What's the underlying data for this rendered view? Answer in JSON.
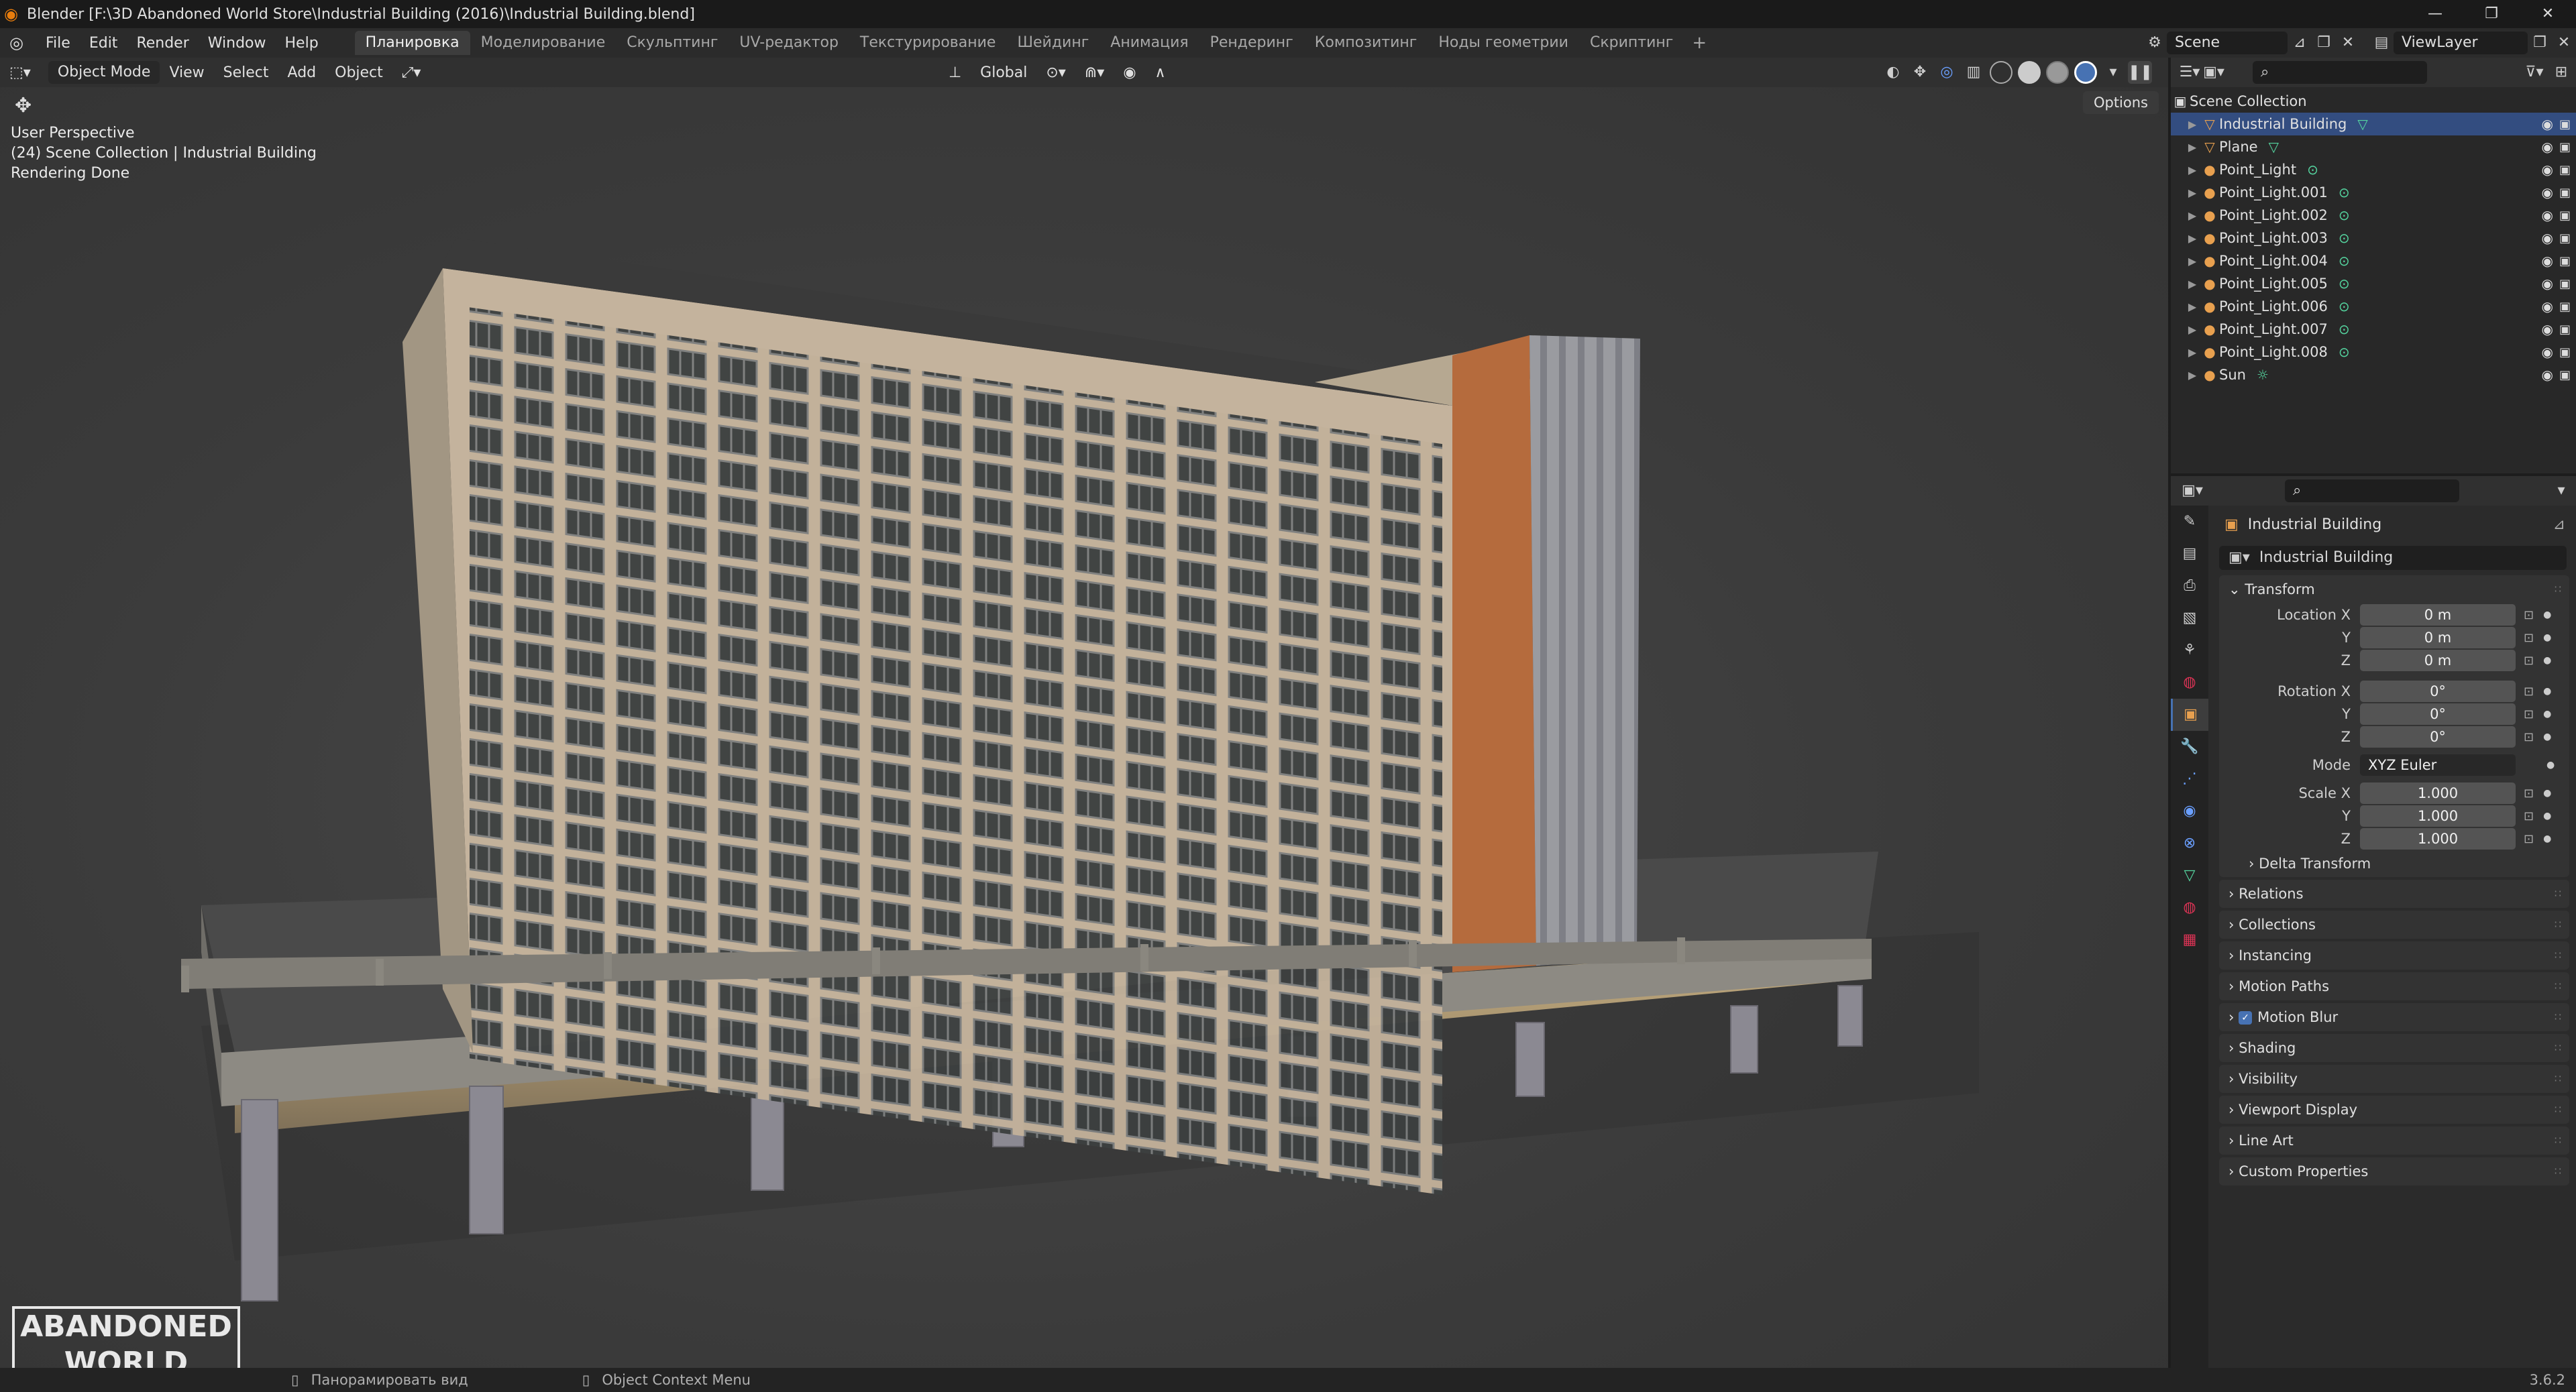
{
  "window": {
    "title": "Blender [F:\\3D Abandoned World Store\\Industrial Building (2016)\\Industrial Building.blend]",
    "controls": [
      "—",
      "❐",
      "✕"
    ]
  },
  "menu": {
    "items": [
      "File",
      "Edit",
      "Render",
      "Window",
      "Help"
    ]
  },
  "workspaces": [
    "Планировка",
    "Моделирование",
    "Скульптинг",
    "UV-редактор",
    "Текстурирование",
    "Шейдинг",
    "Анимация",
    "Рендеринг",
    "Композитинг",
    "Ноды геометрии",
    "Скриптинг"
  ],
  "active_workspace": "Планировка",
  "scene": {
    "name": "Scene",
    "view_layer": "ViewLayer"
  },
  "viewport_header": {
    "mode": "Object Mode",
    "menus": [
      "View",
      "Select",
      "Add",
      "Object"
    ],
    "orientation": "Global"
  },
  "viewport": {
    "perspective": "User Perspective",
    "collection_info": "(24) Scene Collection | Industrial Building",
    "render_status": "Rendering Done",
    "options_label": "Options",
    "logo_line1": "ABANDONED",
    "logo_line2": "WORLD"
  },
  "outliner": {
    "root": "Scene Collection",
    "items": [
      {
        "name": "Industrial Building",
        "type": "mesh",
        "selected": true
      },
      {
        "name": "Plane",
        "type": "mesh",
        "selected": false
      },
      {
        "name": "Point_Light",
        "type": "light",
        "selected": false
      },
      {
        "name": "Point_Light.001",
        "type": "light",
        "selected": false
      },
      {
        "name": "Point_Light.002",
        "type": "light",
        "selected": false
      },
      {
        "name": "Point_Light.003",
        "type": "light",
        "selected": false
      },
      {
        "name": "Point_Light.004",
        "type": "light",
        "selected": false
      },
      {
        "name": "Point_Light.005",
        "type": "light",
        "selected": false
      },
      {
        "name": "Point_Light.006",
        "type": "light",
        "selected": false
      },
      {
        "name": "Point_Light.007",
        "type": "light",
        "selected": false
      },
      {
        "name": "Point_Light.008",
        "type": "light",
        "selected": false
      },
      {
        "name": "Sun",
        "type": "sun",
        "selected": false
      }
    ]
  },
  "properties": {
    "object_name": "Industrial Building",
    "data_name": "Industrial Building",
    "transform_label": "Transform",
    "location": {
      "label": "Location X",
      "x": "0 m",
      "y": "0 m",
      "z": "0 m"
    },
    "rotation": {
      "label": "Rotation X",
      "x": "0°",
      "y": "0°",
      "z": "0°"
    },
    "mode": {
      "label": "Mode",
      "value": "XYZ Euler"
    },
    "scale": {
      "label": "Scale X",
      "x": "1.000",
      "y": "1.000",
      "z": "1.000"
    },
    "axis_y": "Y",
    "axis_z": "Z",
    "delta": "Delta Transform",
    "panels": [
      "Relations",
      "Collections",
      "Instancing",
      "Motion Paths",
      "Motion Blur",
      "Shading",
      "Visibility",
      "Viewport Display",
      "Line Art",
      "Custom Properties"
    ]
  },
  "statusbar": {
    "pan": "Панорамировать вид",
    "context": "Object Context Menu",
    "version": "3.6.2"
  },
  "colors": {
    "accent": "#4772b3",
    "selection": "#334d80",
    "object_icon": "#e8a04f",
    "data_icon": "#55d6a0"
  }
}
